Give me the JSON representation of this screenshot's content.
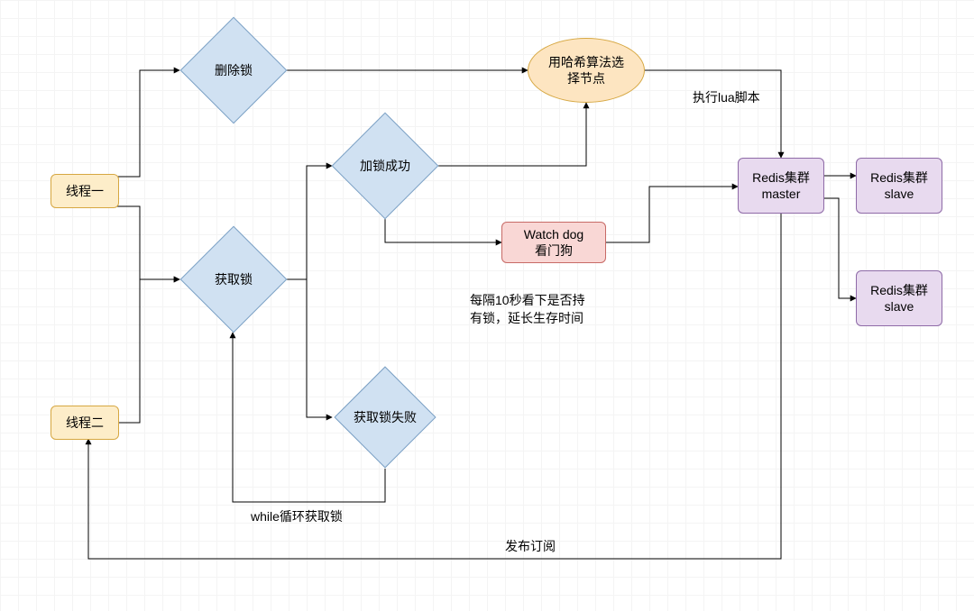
{
  "nodes": {
    "thread1": {
      "label": "线程一"
    },
    "thread2": {
      "label": "线程二"
    },
    "delete": {
      "label": "删除锁"
    },
    "acquire": {
      "label": "获取锁"
    },
    "success": {
      "label": "加锁成功"
    },
    "fail": {
      "label": "获取锁失败"
    },
    "hash": {
      "label": "用哈希算法选\n择节点"
    },
    "watchdog": {
      "label": "Watch dog\n看门狗"
    },
    "master": {
      "label": "Redis集群\nmaster"
    },
    "slave1": {
      "label": "Redis集群\nslave"
    },
    "slave2": {
      "label": "Redis集群\nslave"
    }
  },
  "labels": {
    "lua": "执行lua脚本",
    "interval": "每隔10秒看下是否持\n有锁，延长生存时间",
    "whileloop": "while循环获取锁",
    "pubsub": "发布订阅"
  }
}
